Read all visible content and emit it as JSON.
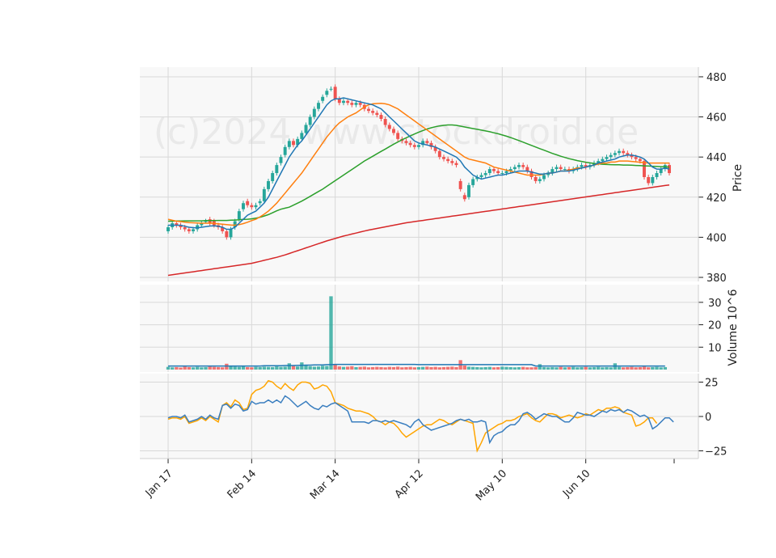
{
  "watermark": "(c)2024 www.stockdroid.de",
  "chart_data": {
    "type": "candlestick",
    "x_tick_labels": [
      "Jan 17",
      "Feb 14",
      "Mar 14",
      "Apr 12",
      "May 10",
      "Jun 10"
    ],
    "x_tick_index": [
      0,
      20,
      40,
      60,
      80,
      100
    ],
    "price_panel": {
      "ylabel": "Price",
      "ylim": [
        380,
        482
      ],
      "ticks": [
        380,
        400,
        420,
        440,
        460,
        480
      ],
      "close": [
        405,
        407,
        406,
        405,
        404,
        403,
        404,
        406,
        407,
        408,
        407,
        406,
        405,
        403,
        400,
        404,
        408,
        413,
        417,
        416,
        415,
        416,
        418,
        424,
        428,
        432,
        436,
        440,
        445,
        448,
        446,
        449,
        452,
        456,
        460,
        464,
        467,
        470,
        473,
        474,
        469,
        467,
        468,
        467,
        466,
        467,
        466,
        464,
        463,
        462,
        461,
        459,
        456,
        454,
        452,
        449,
        448,
        447,
        446,
        445,
        446,
        448,
        447,
        445,
        443,
        440,
        439,
        438,
        437,
        436,
        424,
        419,
        426,
        429,
        430,
        431,
        432,
        434,
        433,
        432,
        432,
        433,
        434,
        435,
        436,
        435,
        433,
        430,
        428,
        429,
        431,
        432,
        434,
        435,
        434,
        434,
        433,
        434,
        435,
        436,
        435,
        436,
        437,
        438,
        439,
        440,
        441,
        442,
        443,
        442,
        441,
        440,
        439,
        438,
        430,
        427,
        430,
        432,
        434,
        436,
        432
      ],
      "open": [
        403,
        405,
        407,
        406,
        405,
        404,
        403,
        404,
        406,
        408,
        409,
        408,
        406,
        405,
        403,
        400,
        405,
        409,
        414,
        418,
        416,
        415,
        417,
        418,
        424,
        428,
        432,
        437,
        441,
        445,
        448,
        446,
        449,
        452,
        456,
        460,
        464,
        468,
        471,
        474,
        475,
        469,
        467,
        468,
        467,
        466,
        467,
        466,
        464,
        463,
        462,
        461,
        459,
        456,
        454,
        452,
        449,
        448,
        447,
        446,
        445,
        446,
        448,
        447,
        445,
        443,
        440,
        439,
        438,
        437,
        428,
        421,
        420,
        426,
        429,
        430,
        431,
        432,
        434,
        433,
        432,
        432,
        433,
        434,
        435,
        436,
        435,
        433,
        430,
        428,
        429,
        431,
        432,
        434,
        435,
        434,
        434,
        433,
        434,
        435,
        436,
        435,
        436,
        437,
        438,
        439,
        440,
        441,
        442,
        443,
        442,
        441,
        440,
        439,
        438,
        430,
        427,
        430,
        432,
        434,
        436
      ],
      "ma_short": [
        406,
        406,
        406,
        406,
        405.5,
        405,
        404.8,
        404.7,
        405,
        405.3,
        405.6,
        405.7,
        405.5,
        405,
        404,
        404,
        405,
        407,
        409,
        411,
        412,
        413,
        415,
        417,
        420,
        424,
        428,
        432,
        436,
        440,
        443,
        446,
        448,
        451,
        454,
        457,
        460,
        463,
        466,
        468,
        469,
        469,
        469.5,
        469,
        468.5,
        468,
        467.5,
        467,
        466.5,
        466,
        465,
        464,
        462,
        460,
        458,
        456,
        454,
        452,
        450,
        448,
        447,
        446.5,
        446,
        445.5,
        445,
        444,
        443,
        442,
        441,
        440,
        438,
        435,
        433,
        431,
        430,
        429,
        429.5,
        430,
        430.5,
        431,
        431,
        431.5,
        432,
        432.5,
        433,
        433,
        433,
        432.5,
        432,
        431.5,
        431.5,
        432,
        432,
        432.5,
        433,
        433,
        433,
        433.5,
        434,
        434.5,
        435,
        435.5,
        436,
        437,
        437.5,
        438,
        438.5,
        439,
        440,
        440.5,
        441,
        441,
        440.5,
        440,
        439,
        437,
        435,
        434,
        434,
        434.5,
        434
      ],
      "ma_mid": [
        409,
        408.5,
        408,
        407.8,
        407.5,
        407.3,
        407.2,
        407.1,
        407,
        407,
        407,
        406.9,
        406.7,
        406.5,
        406.3,
        406.1,
        406,
        406.3,
        406.8,
        407.5,
        408.3,
        409,
        410.2,
        411.5,
        413,
        415,
        417,
        419.5,
        422,
        424.5,
        427,
        429.5,
        432,
        435,
        438,
        441,
        444,
        447,
        450,
        452.5,
        455,
        457,
        458.5,
        460,
        461,
        462,
        463.5,
        465,
        466,
        466.5,
        466.7,
        466.8,
        466.5,
        466,
        465,
        464,
        462.5,
        461,
        459.5,
        458,
        456.5,
        455,
        453.5,
        452,
        450.5,
        449,
        447.5,
        446,
        444.5,
        443,
        441.5,
        440,
        439,
        438.5,
        438,
        437.5,
        437,
        436,
        435,
        434.5,
        434,
        433.5,
        433,
        432.5,
        432,
        431.5,
        431,
        431,
        431,
        431,
        431.5,
        432,
        432,
        432.5,
        433,
        433,
        433.5,
        434,
        434.5,
        434.5,
        435,
        435.5,
        436,
        436.5,
        437,
        437,
        437.5,
        437.5,
        438,
        438,
        438,
        437.8,
        437.6,
        437.4,
        437.2,
        437,
        437,
        437,
        437,
        437,
        437
      ],
      "ma_long": [
        408,
        408,
        408.1,
        408.1,
        408.2,
        408.2,
        408.2,
        408.2,
        408.2,
        408.3,
        408.3,
        408.3,
        408.4,
        408.4,
        408.4,
        408.5,
        408.6,
        408.7,
        408.9,
        409,
        409.2,
        409.5,
        410,
        410.6,
        411.3,
        412.2,
        413.2,
        414,
        414.5,
        415,
        416,
        417,
        418,
        419.2,
        420.4,
        421.6,
        422.8,
        424,
        425.4,
        426.8,
        428.2,
        429.6,
        431,
        432.4,
        433.8,
        435.2,
        436.6,
        438,
        439.2,
        440.4,
        441.6,
        442.8,
        444,
        445.2,
        446.4,
        447.5,
        448.6,
        449.6,
        450.6,
        451.5,
        452.4,
        453.2,
        454,
        454.6,
        455.1,
        455.5,
        455.8,
        456,
        456,
        455.8,
        455.4,
        455,
        454.6,
        454.2,
        453.8,
        453.4,
        453,
        452.6,
        452.1,
        451.6,
        451,
        450.4,
        449.7,
        449,
        448.2,
        447.4,
        446.6,
        445.8,
        445,
        444.2,
        443.4,
        442.6,
        441.8,
        441.1,
        440.4,
        439.8,
        439.2,
        438.7,
        438.2,
        437.8,
        437.4,
        437.1,
        436.8,
        436.6,
        436.4,
        436.3,
        436.2,
        436.1,
        436.1,
        436,
        436,
        435.9,
        435.8,
        435.7,
        435.6,
        435.5,
        435.4,
        435.3,
        435.2,
        435.1,
        435
      ],
      "ma_200": [
        381,
        381.3,
        381.6,
        381.9,
        382.2,
        382.5,
        382.8,
        383.1,
        383.4,
        383.7,
        384,
        384.3,
        384.6,
        384.9,
        385.2,
        385.5,
        385.8,
        386.1,
        386.4,
        386.7,
        387,
        387.5,
        388,
        388.5,
        389,
        389.5,
        390,
        390.6,
        391.2,
        391.9,
        392.6,
        393.3,
        394,
        394.7,
        395.4,
        396.1,
        396.8,
        397.5,
        398.2,
        398.8,
        399.4,
        400,
        400.6,
        401.1,
        401.6,
        402.1,
        402.6,
        403.1,
        403.6,
        404,
        404.4,
        404.8,
        405.2,
        405.6,
        406,
        406.4,
        406.8,
        407.2,
        407.5,
        407.8,
        408.1,
        408.4,
        408.7,
        409,
        409.3,
        409.6,
        409.9,
        410.2,
        410.5,
        410.8,
        411.1,
        411.4,
        411.7,
        412,
        412.3,
        412.6,
        412.9,
        413.2,
        413.5,
        413.8,
        414.1,
        414.4,
        414.7,
        415,
        415.3,
        415.6,
        415.9,
        416.2,
        416.5,
        416.8,
        417.1,
        417.4,
        417.7,
        418,
        418.3,
        418.6,
        418.9,
        419.2,
        419.5,
        419.8,
        420.1,
        420.4,
        420.7,
        421,
        421.3,
        421.6,
        421.9,
        422.2,
        422.5,
        422.8,
        423.1,
        423.4,
        423.7,
        424,
        424.3,
        424.6,
        424.9,
        425.2,
        425.5,
        425.8,
        426.1
      ]
    },
    "volume_panel": {
      "ylabel": "Volume 10^6",
      "ylim": [
        0,
        35
      ],
      "ticks": [
        10,
        20,
        30
      ],
      "values": [
        1.2,
        1,
        1.1,
        0.9,
        1.3,
        1.1,
        1,
        1.2,
        1,
        1.1,
        1.3,
        1.2,
        1.1,
        1,
        2.6,
        1.8,
        1.3,
        1.2,
        1.4,
        1.1,
        1,
        1.2,
        1.1,
        1.3,
        1.2,
        1.1,
        1.4,
        1.2,
        1.3,
        2.8,
        1.6,
        1.4,
        3.2,
        2,
        1.5,
        1.3,
        1.4,
        1.7,
        1.6,
        32.7,
        2.1,
        1.4,
        1.2,
        1.3,
        1.5,
        1.1,
        1.2,
        1.3,
        1,
        1.1,
        1.2,
        1.1,
        1,
        1.2,
        1.1,
        1.3,
        1,
        1.1,
        1.2,
        1,
        1.1,
        1.2,
        1.3,
        1.1,
        1.2,
        1,
        1.1,
        1.2,
        1.3,
        1.1,
        4.2,
        1.8,
        1.3,
        1.2,
        1.1,
        1,
        1.1,
        1.2,
        1,
        1.1,
        1.3,
        1.2,
        1.1,
        1,
        1.1,
        1.2,
        1,
        1,
        1.1,
        2.4,
        1.1,
        1,
        1.1,
        1,
        1.2,
        1,
        1.1,
        1.2,
        1,
        1.1,
        1.2,
        1,
        1.1,
        1.2,
        1,
        1.1,
        1,
        2.8,
        1.2,
        1,
        1.1,
        1.2,
        1,
        1.1,
        1.3,
        1,
        1.1,
        1.2,
        1,
        1.1
      ],
      "avg": [
        1.6,
        1.6,
        1.6,
        1.6,
        1.6,
        1.6,
        1.6,
        1.6,
        1.6,
        1.6,
        1.6,
        1.6,
        1.6,
        1.6,
        1.6,
        1.6,
        1.6,
        1.6,
        1.6,
        1.6,
        1.6,
        1.6,
        1.6,
        1.7,
        1.7,
        1.7,
        1.7,
        1.7,
        1.8,
        1.8,
        1.8,
        1.9,
        1.9,
        2,
        2,
        2.1,
        2.1,
        2.1,
        2.2,
        2.2,
        2.3,
        2.3,
        2.3,
        2.3,
        2.3,
        2.3,
        2.3,
        2.3,
        2.3,
        2.3,
        2.3,
        2.3,
        2.3,
        2.3,
        2.3,
        2.3,
        2.3,
        2.3,
        2.3,
        2.3,
        2.2,
        2.2,
        2.2,
        2.2,
        2.2,
        2.2,
        2.2,
        2.2,
        2.2,
        2.2,
        2.2,
        2.2,
        2.2,
        2.2,
        2.2,
        2.2,
        2.2,
        2.2,
        2.2,
        2.2,
        2.2,
        2.2,
        2.2,
        2.2,
        2.2,
        2.2,
        2.2,
        2.2,
        1.6,
        1.6,
        1.6,
        1.6,
        1.6,
        1.6,
        1.6,
        1.6,
        1.6,
        1.6,
        1.6,
        1.6,
        1.6,
        1.6,
        1.6,
        1.6,
        1.6,
        1.6,
        1.6,
        1.6,
        1.6,
        1.6,
        1.6,
        1.6,
        1.6,
        1.6,
        1.6,
        1.6,
        1.6,
        1.6,
        1.6,
        1.6
      ]
    },
    "oscillator_panel": {
      "ylim": [
        -30,
        30
      ],
      "ticks": [
        -25,
        0,
        25
      ],
      "blue": [
        -1,
        0,
        0,
        -1,
        1,
        -4,
        -3,
        -2,
        0,
        -2,
        1,
        -1,
        -2,
        8,
        9,
        6,
        9,
        8,
        4,
        5,
        11,
        9,
        10,
        10,
        12,
        10,
        12,
        10,
        15,
        13,
        10,
        7,
        9,
        11,
        8,
        6,
        5,
        8,
        7,
        9,
        10,
        8,
        6,
        4,
        -4,
        -4,
        -4,
        -4,
        -5,
        -3,
        -3,
        -4,
        -3,
        -4,
        -3,
        -4,
        -5,
        -6,
        -8,
        -4,
        -2,
        -6,
        -8,
        -10,
        -9,
        -8,
        -7,
        -6,
        -5,
        -3,
        -2,
        -3,
        -2,
        -4,
        -4,
        -3,
        -4,
        -19,
        -14,
        -12,
        -11,
        -8,
        -6,
        -6,
        -3,
        2,
        3,
        1,
        -2,
        0,
        2,
        1,
        0,
        0,
        -2,
        -4,
        -4,
        -1,
        3,
        2,
        1,
        1,
        0,
        2,
        4,
        3,
        5,
        4,
        5,
        3,
        5,
        4,
        2,
        0,
        1,
        -1,
        -9,
        -7,
        -4,
        -1,
        -1,
        -4
      ],
      "orange": [
        -2,
        -1,
        -1,
        -2,
        0,
        -5,
        -4,
        -3,
        -1,
        -3,
        0,
        -2,
        -4,
        8,
        10,
        7,
        12,
        10,
        5,
        6,
        16,
        19,
        20,
        22,
        26,
        25,
        22,
        20,
        24,
        21,
        19,
        23,
        25,
        25,
        24,
        20,
        21,
        23,
        22,
        18,
        10,
        9,
        8,
        6,
        5,
        4,
        4,
        3,
        2,
        0,
        -3,
        -4,
        -6,
        -4,
        -5,
        -8,
        -12,
        -15,
        -13,
        -11,
        -9,
        -7,
        -6,
        -6,
        -4,
        -2,
        -3,
        -5,
        -6,
        -4,
        -2,
        -3,
        -4,
        -5,
        -25,
        -19,
        -12,
        -10,
        -8,
        -6,
        -5,
        -3,
        -3,
        -2,
        0,
        1,
        2,
        -1,
        -3,
        -4,
        -1,
        2,
        2,
        1,
        -1,
        0,
        1,
        0,
        -1,
        0,
        2,
        1,
        3,
        5,
        4,
        6,
        6,
        7,
        6,
        3,
        2,
        1,
        -7,
        -6,
        -4,
        -1,
        -1,
        -5
      ]
    },
    "colors": {
      "up": "#26a69a",
      "down": "#ef5350",
      "ma_short": "#1f77b4",
      "ma_mid": "#ff7f0e",
      "ma_long": "#2ca02c",
      "ma_200": "#d62728",
      "volume_avg": "#1f77b4",
      "osc_blue": "#3a7ebf",
      "osc_orange": "#ffa500",
      "panel_bg": "#f8f8f8",
      "grid": "#d8d8d8"
    }
  }
}
